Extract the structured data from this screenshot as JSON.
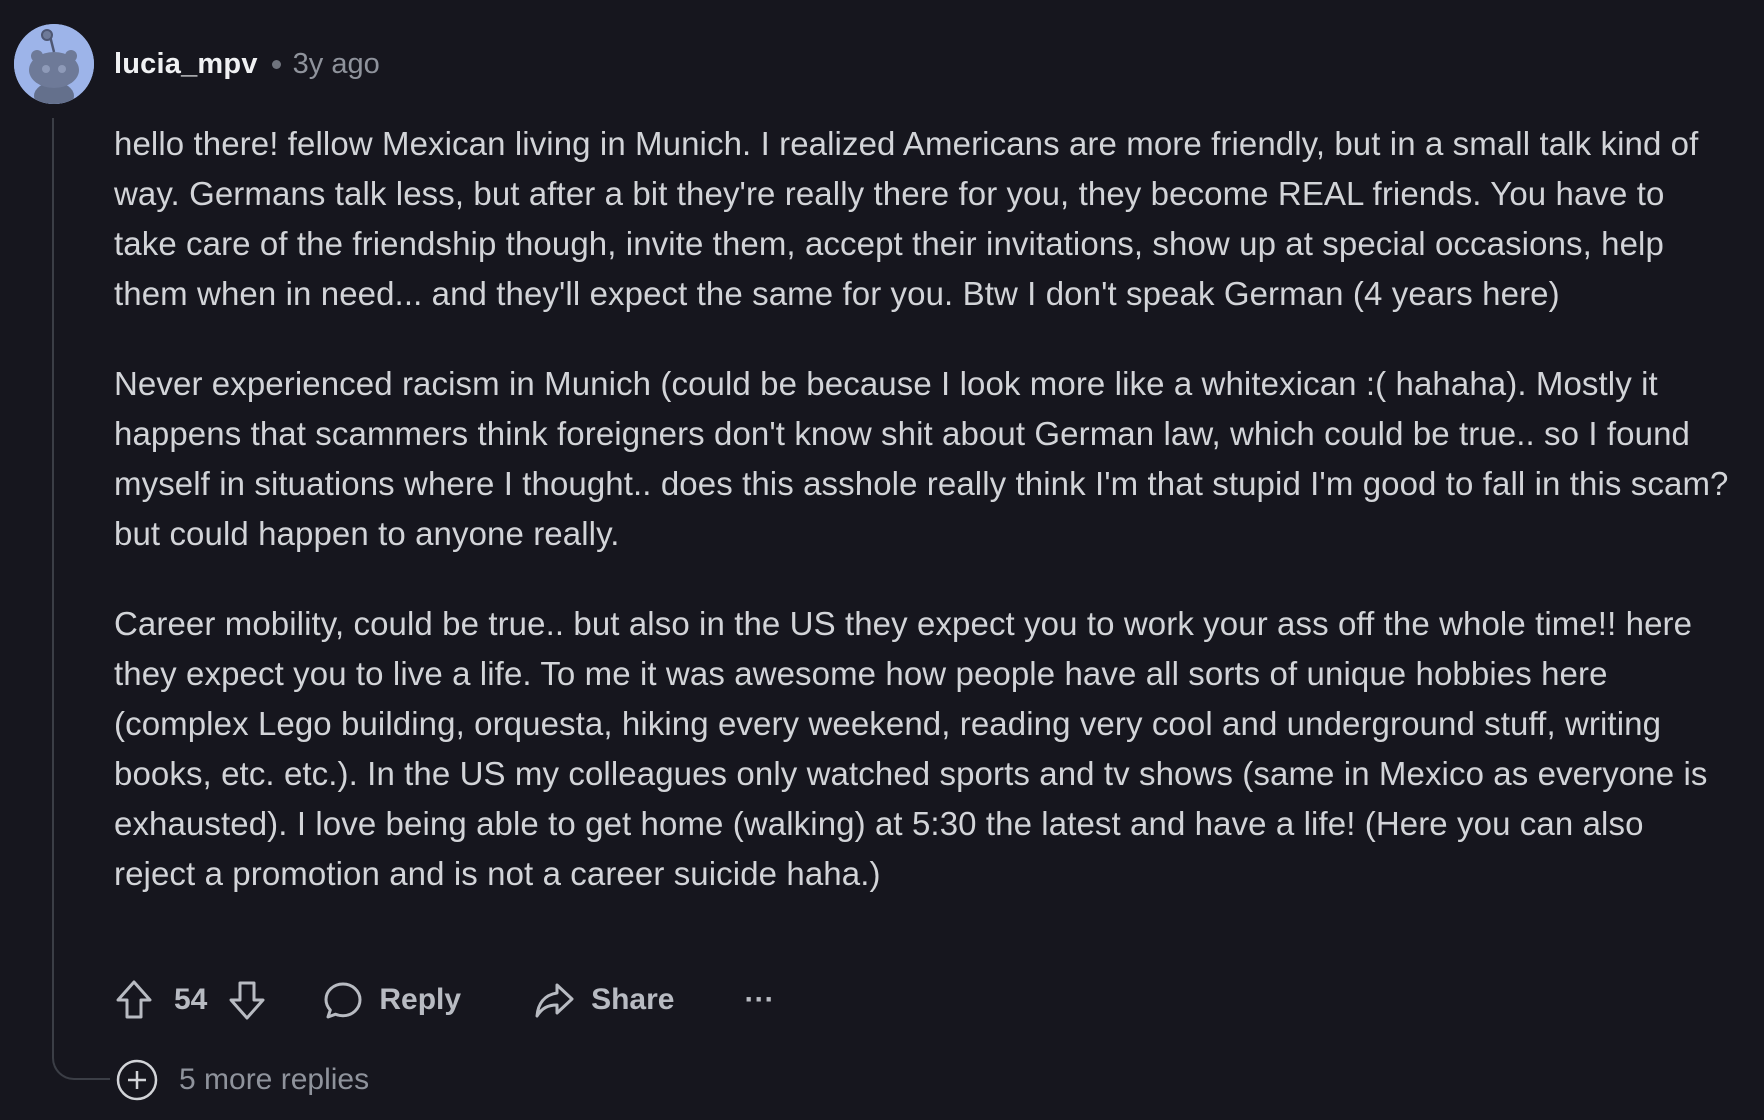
{
  "comment": {
    "username": "lucia_mpv",
    "timestamp": "3y ago",
    "paragraphs": [
      "hello there! fellow Mexican living in Munich. I realized Americans are more friendly, but in a small talk kind of way. Germans talk less, but after a bit they're really there for you, they become REAL friends. You have to take care of the friendship though, invite them, accept their invitations, show up at special occasions, help them when in need... and they'll expect the same for you. Btw I don't speak German (4 years here)",
      "Never experienced racism in Munich (could be because I look more like a whitexican :( hahaha). Mostly it happens that scammers think foreigners don't know shit about German law, which could be true.. so I found myself in situations where I thought.. does this asshole really think I'm that stupid I'm good to fall in this scam? but could happen to anyone really.",
      "Career mobility, could be true.. but also in the US they expect you to work your ass off the whole time!! here they expect you to live a life. To me it was awesome how people have all sorts of unique hobbies here (complex Lego building, orquesta, hiking every weekend, reading very cool and underground stuff, writing books, etc. etc.). In the US my colleagues only watched sports and tv shows (same in Mexico as everyone is exhausted). I love being able to get home (walking) at 5:30 the latest and have a life! (Here you can also reject a promotion and is not a career suicide haha.)"
    ],
    "vote_count": "54",
    "actions": {
      "reply_label": "Reply",
      "share_label": "Share",
      "more_label": "···"
    },
    "more_replies_label": "5 more replies"
  },
  "icons": {
    "avatar": "snoo-avatar",
    "upvote": "arrow-up-icon",
    "downvote": "arrow-down-icon",
    "reply": "speech-bubble-icon",
    "share": "share-arrow-icon",
    "expand": "plus-circle-icon"
  },
  "colors": {
    "background": "#16161e",
    "text": "#d2d4d8",
    "muted": "#8f939c",
    "avatar_bg": "#9db4e9",
    "thread_line": "#3b3e46"
  }
}
